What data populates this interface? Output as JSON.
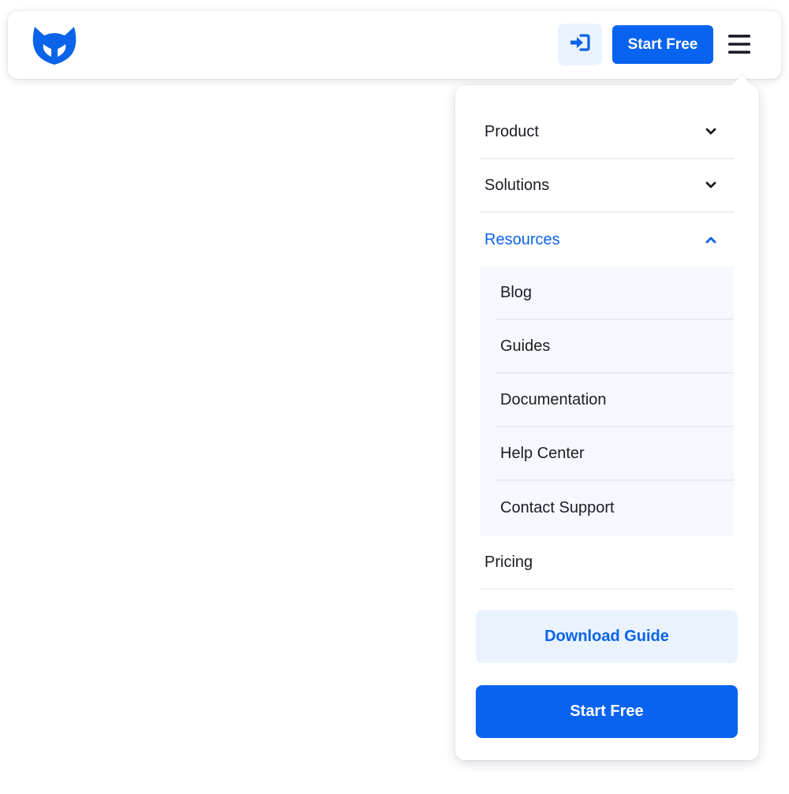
{
  "header": {
    "logo_icon": "fox-head-logo-icon",
    "login_icon": "sign-in-icon",
    "start_label": "Start Free",
    "menu_icon": "hamburger-menu-icon"
  },
  "menu": {
    "items": [
      {
        "label": "Product",
        "icon": "chevron-down-icon",
        "expanded": false
      },
      {
        "label": "Solutions",
        "icon": "chevron-down-icon",
        "expanded": false
      },
      {
        "label": "Resources",
        "icon": "chevron-up-icon",
        "expanded": true
      },
      {
        "label": "Pricing"
      }
    ],
    "resources_sub": [
      {
        "label": "Blog"
      },
      {
        "label": "Guides"
      },
      {
        "label": "Documentation"
      },
      {
        "label": "Help Center"
      },
      {
        "label": "Contact Support"
      }
    ],
    "download_label": "Download Guide",
    "start_label": "Start Free"
  },
  "colors": {
    "accent": "#0863f0",
    "accent_light": "#eaf3fd",
    "active_text": "#0a63e8",
    "text": "#1a1d24"
  }
}
